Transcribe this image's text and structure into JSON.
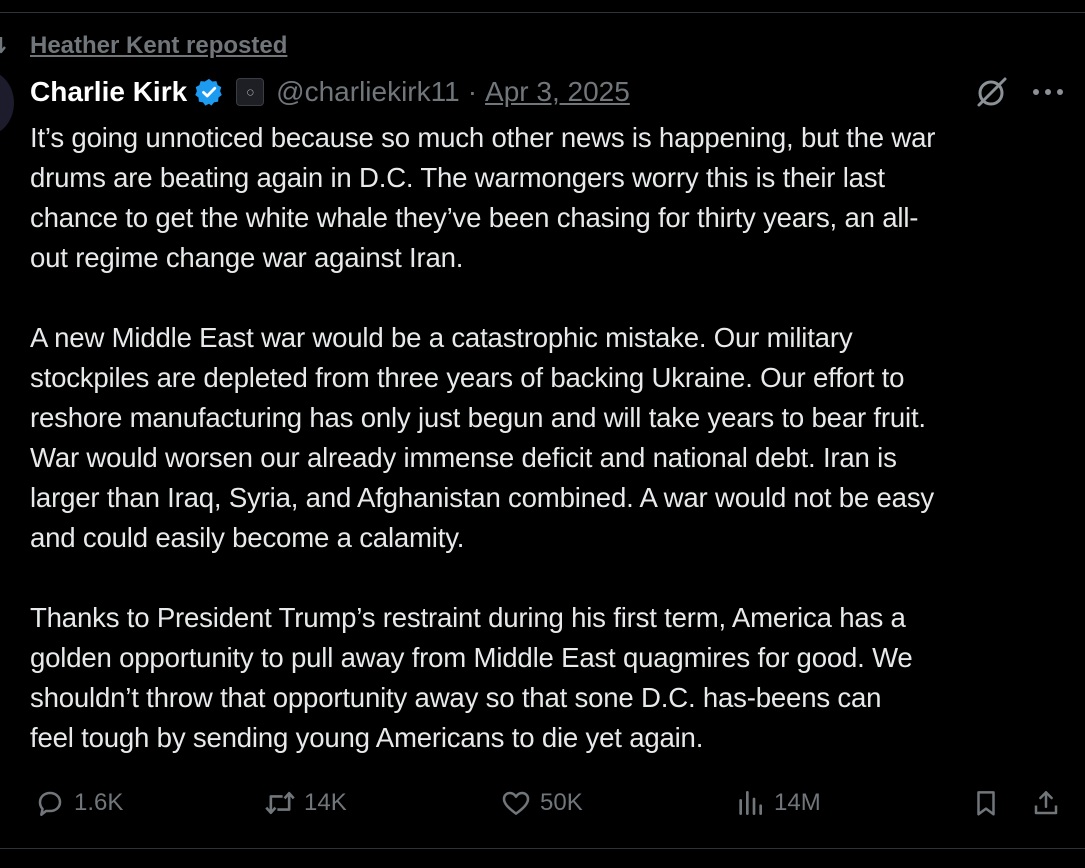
{
  "repost": {
    "text": "Heather Kent reposted"
  },
  "author": {
    "name": "Charlie Kirk",
    "handle": "@charliekirk11",
    "separator": "·",
    "date": "Apr 3, 2025"
  },
  "tweet": {
    "paragraphs": [
      "It’s going unnoticed because so much other news is happening, but the war\ndrums are beating again in D.C. The warmongers worry this is their last\nchance to get the white whale they’ve been chasing for thirty years, an all-\nout regime change war against Iran.",
      "A new Middle East war would be a catastrophic mistake. Our military\nstockpiles are depleted from three years of backing Ukraine. Our effort to\nreshore manufacturing has only just begun and will take years to bear fruit.\nWar would worsen our already immense deficit and national debt. Iran is\nlarger than Iraq, Syria, and Afghanistan combined. A war would not be easy\nand could easily become a calamity.",
      "Thanks to President Trump’s restraint during his first term, America has a\ngolden opportunity to pull away from Middle East quagmires for good. We\nshouldn’t throw that opportunity away so that sone D.C. has-beens can\nfeel tough by sending young Americans to die yet again."
    ]
  },
  "actions": {
    "replies": "1.6K",
    "reposts": "14K",
    "likes": "50K",
    "views": "14M"
  },
  "icons": {
    "repost_context": "repost-icon",
    "verified": "verified-badge-icon",
    "affiliation": "affiliation-badge-icon",
    "grok": "grok-icon",
    "more": "more-icon",
    "reply": "reply-icon",
    "repost": "repost-icon",
    "like": "heart-icon",
    "views": "views-icon",
    "bookmark": "bookmark-icon",
    "share": "share-icon"
  },
  "colors": {
    "background": "#000000",
    "text": "#e7e9ea",
    "muted": "#71767b",
    "verified": "#1d9bf0",
    "divider": "#2f3336"
  }
}
